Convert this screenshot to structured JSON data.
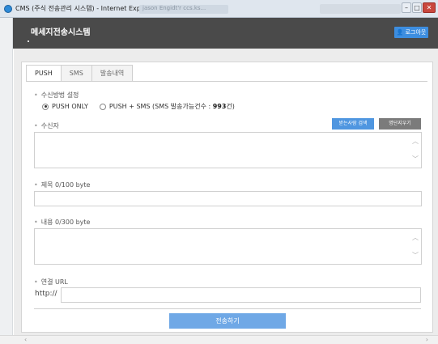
{
  "window": {
    "title": "CMS (주식 전송관리 시스템) - Internet Explorer",
    "bg_tab": "jason Engidt'r ccs.ks...",
    "buttons": {
      "minimize": "–",
      "maximize": "□",
      "close": "✕"
    }
  },
  "header": {
    "app_name": "메세지전송시스템",
    "login_label": "로그아웃",
    "colors": {
      "bar": "#4a4a4a",
      "login": "#3d8ee0"
    }
  },
  "tabs": [
    {
      "label": "PUSH",
      "active": true
    },
    {
      "label": "SMS",
      "active": false
    },
    {
      "label": "발송내역",
      "active": false
    }
  ],
  "form": {
    "receive_method_label": "수신방법 설정",
    "options": [
      {
        "label": "PUSH ONLY",
        "checked": true
      },
      {
        "label_prefix": "PUSH + SMS (SMS 발송가능건수 : ",
        "count": "993",
        "label_suffix": "건)",
        "checked": false
      }
    ],
    "recipient_label": "수신자",
    "search_btn": "받는사람 검색",
    "clear_btn": "명단지우기",
    "subject_label": "제목 0/100 byte",
    "content_label": "내용 0/300 byte",
    "url_label": "연결 URL",
    "url_prefix": "http://",
    "submit_label": "전송하기",
    "icons": {
      "scroll_up": "︿",
      "scroll_down": "﹀"
    }
  }
}
